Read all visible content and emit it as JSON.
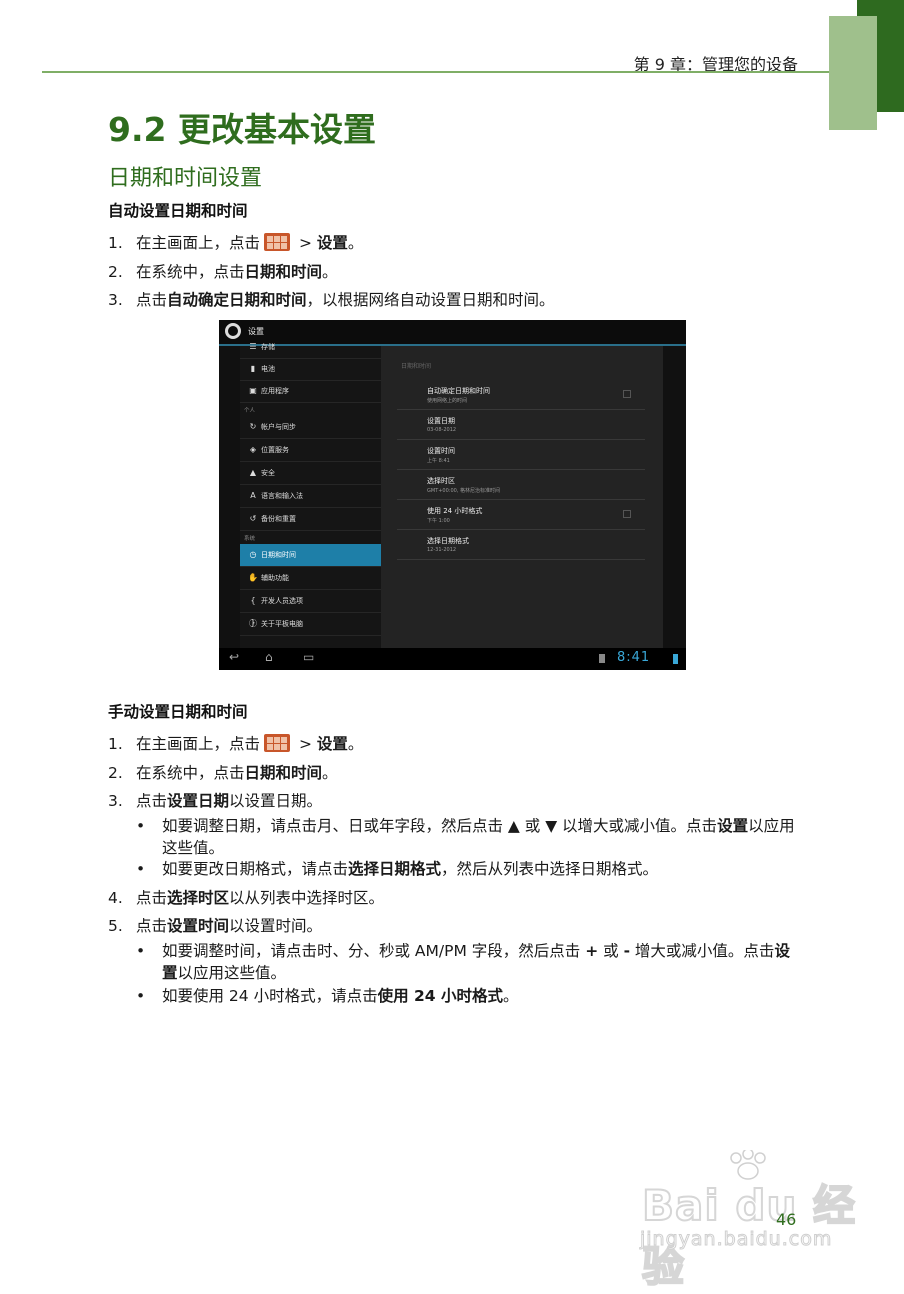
{
  "header": {
    "chapter": "第 9 章：管理您的设备"
  },
  "section_title": "9.2 更改基本设置",
  "subsection_title": "日期和时间设置",
  "auto": {
    "heading": "自动设置日期和时间",
    "steps": [
      {
        "num": "1.",
        "before": "在主画面上，点击",
        "after": " > ",
        "bold": "设置",
        "end": "。"
      },
      {
        "num": "2.",
        "before": "在系统中，点击",
        "bold": "日期和时间",
        "end": "。"
      },
      {
        "num": "3.",
        "before": "点击",
        "bold": "自动确定日期和时间",
        "end": "，以根据网络自动设置日期和时间。"
      }
    ]
  },
  "screenshot": {
    "title": "设置",
    "left_items": [
      {
        "icon": "storage-icon",
        "glyph": "☰",
        "label": "存储"
      },
      {
        "icon": "battery-icon",
        "glyph": "▮",
        "label": "电池"
      },
      {
        "icon": "apps-icon",
        "glyph": "▣",
        "label": "应用程序"
      },
      {
        "icon": "sync-icon",
        "glyph": "↻",
        "label": "帐户与同步"
      },
      {
        "icon": "location-icon",
        "glyph": "◈",
        "label": "位置服务"
      },
      {
        "icon": "lock-icon",
        "glyph": "▲",
        "label": "安全"
      },
      {
        "icon": "language-icon",
        "glyph": "A",
        "label": "语言和输入法"
      },
      {
        "icon": "backup-icon",
        "glyph": "↺",
        "label": "备份和重置"
      },
      {
        "icon": "clock-icon",
        "glyph": "◷",
        "label": "日期和时间"
      },
      {
        "icon": "hand-icon",
        "glyph": "✋",
        "label": "辅助功能"
      },
      {
        "icon": "braces-icon",
        "glyph": "{ }",
        "label": "开发人员选项"
      },
      {
        "icon": "info-icon",
        "glyph": "ⓘ",
        "label": "关于平板电脑"
      }
    ],
    "section_personal": "个人",
    "section_system": "系统",
    "right_header": "日期和时间",
    "rows": [
      {
        "title": "自动确定日期和时间",
        "sub": "使用网络上的时间",
        "checkbox": true
      },
      {
        "title": "设置日期",
        "sub": "03-08-2012",
        "checkbox": false
      },
      {
        "title": "设置时间",
        "sub": "上午 8:41",
        "checkbox": false
      },
      {
        "title": "选择时区",
        "sub": "GMT+00:00, 格林尼治标准时间",
        "checkbox": false
      },
      {
        "title": "使用 24 小时格式",
        "sub": "下午 1:00",
        "checkbox": true
      },
      {
        "title": "选择日期格式",
        "sub": "12-31-2012",
        "checkbox": false
      }
    ],
    "clock": "8:41",
    "nav": {
      "back": "↩",
      "home": "⌂",
      "recent": "▭"
    }
  },
  "manual": {
    "heading": "手动设置日期和时间",
    "step1": {
      "num": "1.",
      "before": "在主画面上，点击",
      "after": " > ",
      "bold": "设置",
      "end": "。"
    },
    "step2": {
      "num": "2.",
      "before": "在系统中，点击",
      "bold": "日期和时间",
      "end": "。"
    },
    "step3": {
      "num": "3.",
      "before": "点击",
      "bold": "设置日期",
      "end": "以设置日期。"
    },
    "bullet3a": {
      "t1": "如要调整日期，请点击月、日或年字段，然后点击 ▲ 或 ▼ 以增大或减小值。点击",
      "b": "设置",
      "t2": "以应用这些值。"
    },
    "bullet3b": {
      "t1": "如要更改日期格式，请点击",
      "b": "选择日期格式",
      "t2": "，然后从列表中选择日期格式。"
    },
    "step4": {
      "num": "4.",
      "before": "点击",
      "bold": "选择时区",
      "end": "以从列表中选择时区。"
    },
    "step5": {
      "num": "5.",
      "before": "点击",
      "bold": "设置时间",
      "end": "以设置时间。"
    },
    "bullet5a": {
      "t1": "如要调整时间，请点击时、分、秒或 AM/PM 字段，然后点击 ",
      "b1": "+",
      "t2": " 或 ",
      "b2": "-",
      "t3": " 增大或减小值。点击",
      "b3": "设置",
      "t4": "以应用这些值。"
    },
    "bullet5b": {
      "t1": "如要使用 24 小时格式，请点击",
      "b": "使用 24 小时格式",
      "t2": "。"
    }
  },
  "page_number": "46",
  "watermark": {
    "brand": "Bai du 经验",
    "url": "jingyan.baidu.com"
  },
  "colors": {
    "accent_green": "#2f6d1e",
    "tab_light": "#9fc08c",
    "android_blue": "#1e7fa8"
  }
}
